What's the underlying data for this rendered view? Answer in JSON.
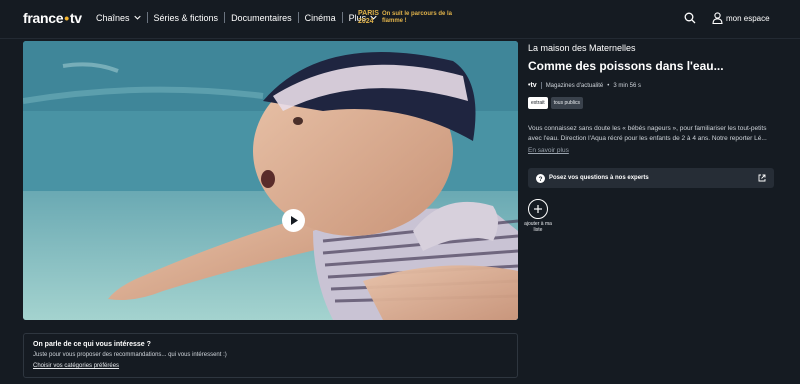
{
  "header": {
    "logo_left": "france",
    "logo_dot": "•",
    "logo_right": "tv",
    "nav": [
      {
        "label": "Chaînes"
      },
      {
        "label": "Séries & fictions"
      },
      {
        "label": "Documentaires"
      },
      {
        "label": "Cinéma"
      },
      {
        "label": "Plus"
      }
    ],
    "paris_logo": "PARIS 2024",
    "paris_text": "On suit le parcours de la flamme !",
    "account_label": "mon espace"
  },
  "video": {
    "show_title": "La maison des Maternelles",
    "episode_title": "Comme des poissons dans l'eau...",
    "channel": "•tv",
    "category": "Magazines d'actualité",
    "duration": "3 min 56 s",
    "tags": [
      "extrait",
      "tous publics"
    ],
    "description": "Vous connaissez sans doute les « bébés nageurs », pour familiariser les tout-petits avec l'eau. Direction l'Aqua récré pour les enfants de 2 à 4 ans. Notre reporter Lé...",
    "more_label": "En savoir plus",
    "question_label": "Posez vos questions à nos experts",
    "add_label": "ajouter à ma liste"
  },
  "recommendations": {
    "title": "On parle de ce qui vous intéresse ?",
    "subtitle": "Juste pour vous proposer des recommandations... qui vous intéressent :)",
    "link": "Choisir vos catégories préférées"
  },
  "colors": {
    "background": "#151b22",
    "accent": "#f5b52e",
    "paris": "#e0b24a"
  }
}
